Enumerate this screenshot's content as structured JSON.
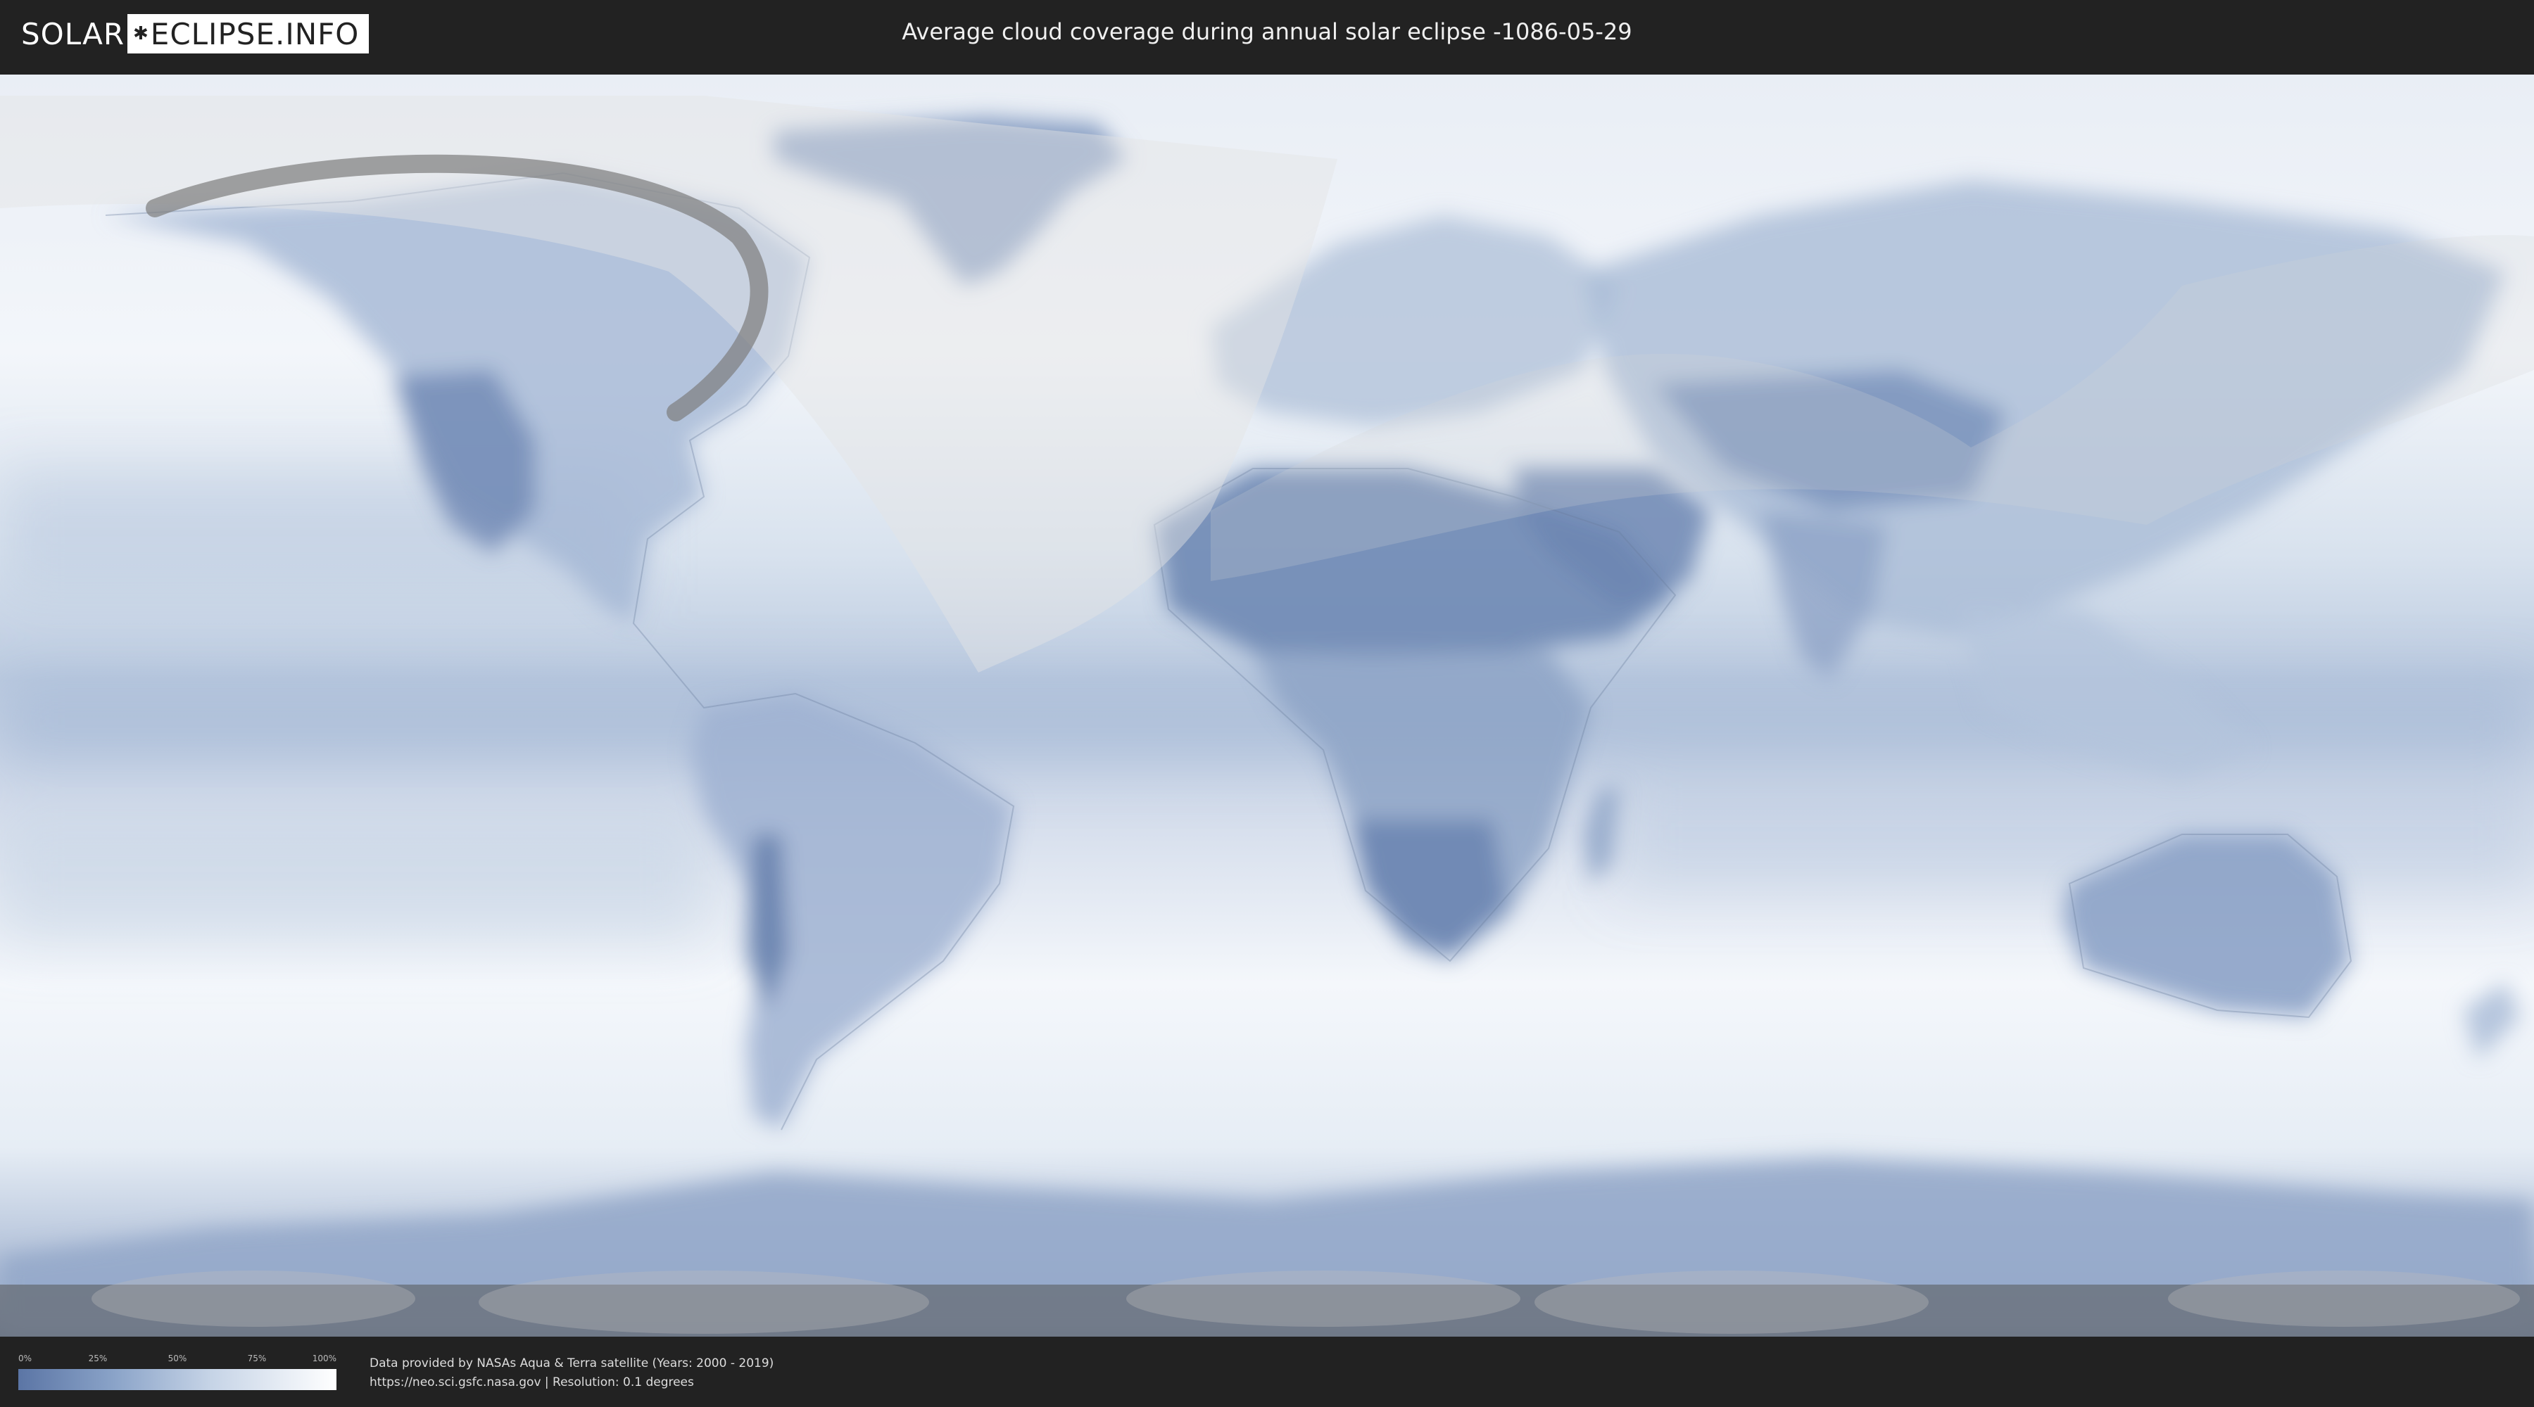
{
  "header": {
    "logo_left": "SOLAR",
    "logo_right": "ECLIPSE.INFO",
    "title": "Average cloud coverage during annual solar eclipse -1086-05-29"
  },
  "legend": {
    "ticks": [
      {
        "label": "0%",
        "value": 0
      },
      {
        "label": "25%",
        "value": 25
      },
      {
        "label": "50%",
        "value": 50
      },
      {
        "label": "75%",
        "value": 75
      },
      {
        "label": "100%",
        "value": 100
      }
    ],
    "colors": {
      "low": "#5b75a5",
      "mid": "#c5d3e6",
      "high": "#ffffff"
    }
  },
  "footer": {
    "credit_line1": "Data provided by NASAs Aqua & Terra satellite (Years: 2000 - 2019)",
    "credit_line2": "https://neo.sci.gsfc.nasa.gov | Resolution: 0.1 degrees"
  },
  "map": {
    "projection": "equirectangular",
    "colors": {
      "ocean_cloud": "#dfe7f1",
      "clear_sky": "#6e89b6",
      "eclipse_shadow": "#777777"
    }
  }
}
